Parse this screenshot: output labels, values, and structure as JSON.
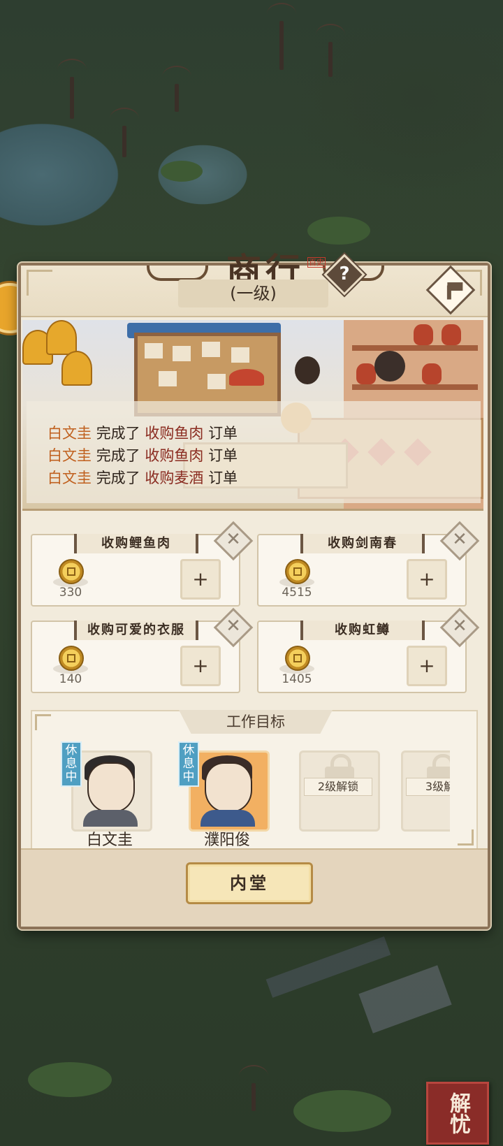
{
  "panel": {
    "title": "商行",
    "title_seal": "百史",
    "help_label": "?",
    "level": "(一级)"
  },
  "activity_log": [
    {
      "name": "白文圭",
      "verb": "完成了",
      "task": "收购鱼肉",
      "suffix": "订单"
    },
    {
      "name": "白文圭",
      "verb": "完成了",
      "task": "收购鱼肉",
      "suffix": "订单"
    },
    {
      "name": "白文圭",
      "verb": "完成了",
      "task": "收购麦酒",
      "suffix": "订单"
    }
  ],
  "orders": [
    {
      "title": "收购鲤鱼肉",
      "price": "330",
      "add_label": "+",
      "close_label": "✕"
    },
    {
      "title": "收购剑南春",
      "price": "4515",
      "add_label": "+",
      "close_label": "✕"
    },
    {
      "title": "收购可爱的衣服",
      "price": "140",
      "add_label": "+",
      "close_label": "✕"
    },
    {
      "title": "收购虹鳟",
      "price": "1405",
      "add_label": "+",
      "close_label": "✕"
    }
  ],
  "work_goal": {
    "title": "工作目标",
    "workers": [
      {
        "name": "白文圭",
        "status": "休息中"
      },
      {
        "name": "濮阳俊",
        "status": "休息中"
      }
    ],
    "locked_slots": [
      {
        "label": "2级解锁"
      },
      {
        "label": "3级解"
      }
    ]
  },
  "footer": {
    "button_label": "内堂"
  },
  "overlay": {
    "seal_text": "解忧"
  },
  "colors": {
    "accent": "#c0601e",
    "task": "#8a2b20",
    "panel_border": "#8c7358",
    "badge": "#4f9fc2"
  },
  "icons": [
    "coin-icon",
    "hammer-icon",
    "help-icon",
    "close-icon",
    "lock-icon",
    "bell-icon"
  ]
}
